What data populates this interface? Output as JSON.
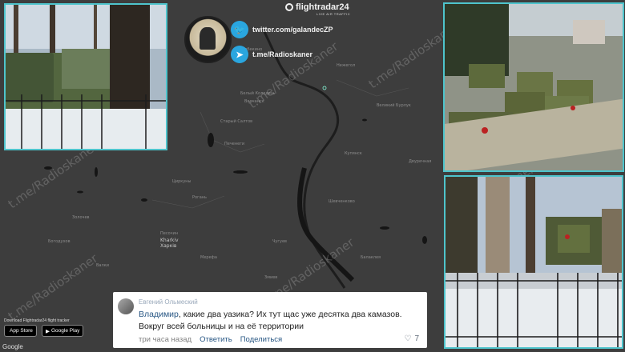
{
  "header": {
    "logo_text": "flightradar24",
    "logo_sub": "LIVE AIR TRAFFIC"
  },
  "social": {
    "twitter_label": "twitter.com/galandecZP",
    "telegram_label": "t.me/Radioskaner",
    "twitter_icon": "twitter-bird-icon",
    "telegram_icon": "telegram-plane-icon"
  },
  "watermark": "t.me/Radioskaner",
  "map": {
    "city_main": "Kharkiv",
    "city_main_ru": "Харків"
  },
  "comment": {
    "author": "Евгений Ольмеский",
    "mention": "Владимир",
    "text_line1": ", какие два уазика? Их тут щас уже десятка два камазов.",
    "text_line2": "Вокруг всей больницы и на её территории",
    "time": "три часа назад",
    "reply": "Ответить",
    "share": "Поделиться",
    "likes": "7"
  },
  "footer": {
    "download_text": "Download Flightradar24 flight tracker",
    "app_store": "App Store",
    "google_play": "Google Play",
    "google": "Google"
  },
  "colors": {
    "frame": "#4ec4cc",
    "map_bg": "#3d3d3d",
    "twitter": "#2aa6df"
  }
}
